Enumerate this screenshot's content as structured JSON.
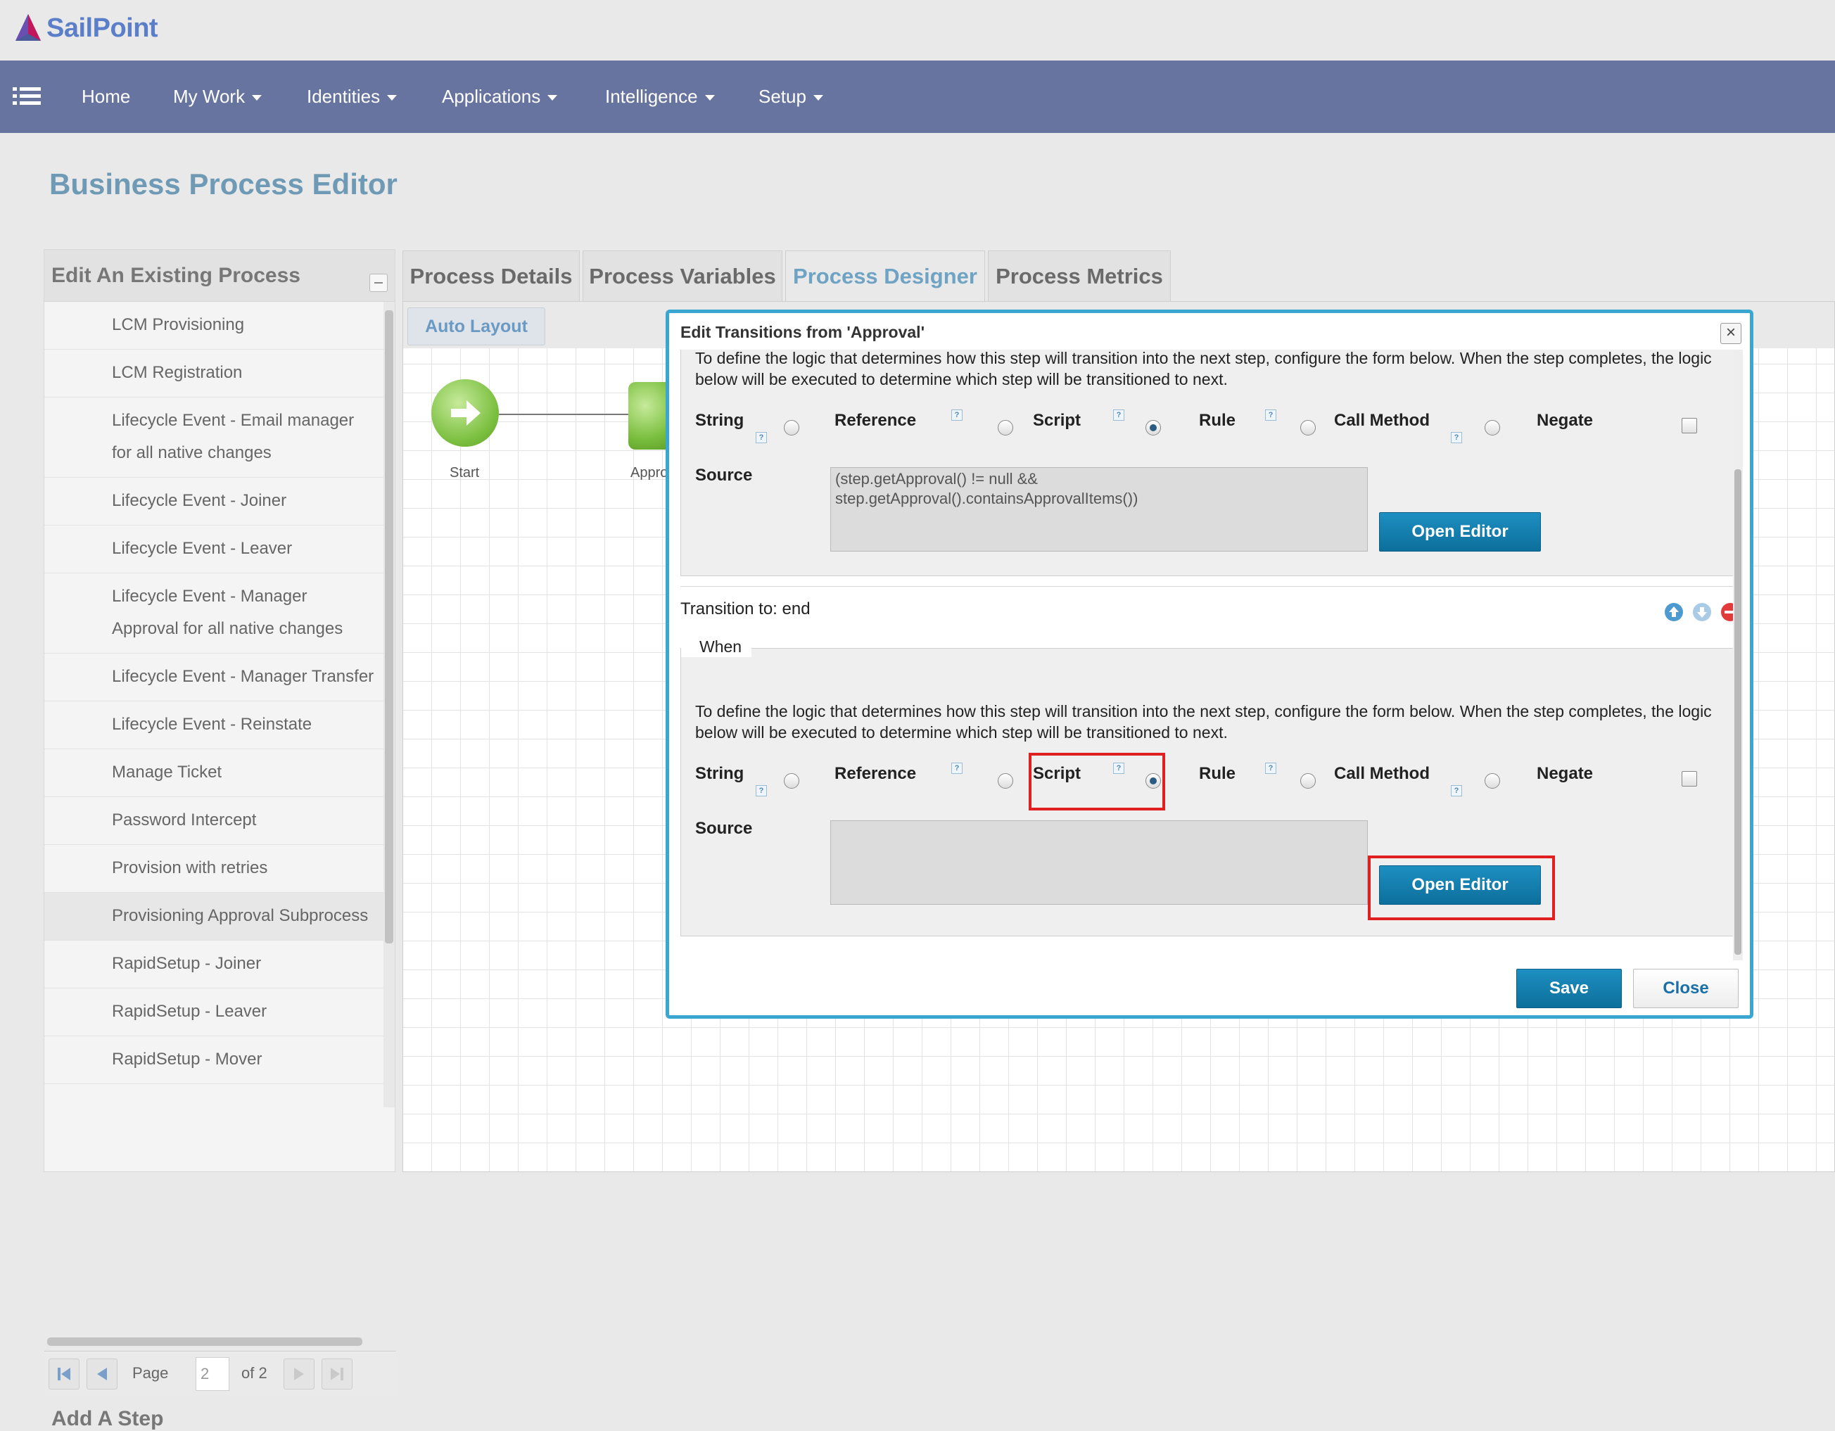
{
  "app": {
    "brand": "SailPoint",
    "brand_color": "#5b7ec9"
  },
  "nav": {
    "menu_icon": "list-icon",
    "items": [
      {
        "label": "Home",
        "dropdown": false
      },
      {
        "label": "My Work",
        "dropdown": true
      },
      {
        "label": "Identities",
        "dropdown": true
      },
      {
        "label": "Applications",
        "dropdown": true
      },
      {
        "label": "Intelligence",
        "dropdown": true
      },
      {
        "label": "Setup",
        "dropdown": true
      }
    ]
  },
  "page": {
    "title": "Business Process Editor"
  },
  "left_panel": {
    "title": "Edit An Existing Process",
    "items": [
      "LCM Provisioning",
      "LCM Registration",
      "Lifecycle Event - Email manager for all native changes",
      "Lifecycle Event - Joiner",
      "Lifecycle Event - Leaver",
      "Lifecycle Event - Manager Approval for all native changes",
      "Lifecycle Event - Manager Transfer",
      "Lifecycle Event - Reinstate",
      "Manage Ticket",
      "Password Intercept",
      "Provision with retries",
      "Provisioning Approval Subprocess",
      "RapidSetup - Joiner",
      "RapidSetup - Leaver",
      "RapidSetup - Mover"
    ],
    "selected_index": 11,
    "pager": {
      "page_label": "Page",
      "page_value": "2",
      "of_label": "of 2"
    },
    "add_step_title": "Add A Step"
  },
  "tabs": [
    {
      "label": "Process Details",
      "active": false
    },
    {
      "label": "Process Variables",
      "active": false
    },
    {
      "label": "Process Designer",
      "active": true
    },
    {
      "label": "Process Metrics",
      "active": false
    }
  ],
  "designer": {
    "auto_layout_label": "Auto Layout",
    "start_label": "Start",
    "approval_label": "Appro"
  },
  "dialog": {
    "title": "Edit Transitions from 'Approval'",
    "description": "To define the logic that determines how this step will transition into the next step, configure the form below. When the step completes, the logic below will be executed to determine which step will be transitioned to next.",
    "options": [
      "String",
      "Reference",
      "Script",
      "Rule",
      "Call Method",
      "Negate"
    ],
    "source_label": "Source",
    "open_editor_label": "Open Editor",
    "help_glyph": "?",
    "transition_1": {
      "selected_option": "Script",
      "source_value": "(step.getApproval() != null &&\nstep.getApproval().containsApprovalItems())"
    },
    "transition_2": {
      "label": "Transition to: end",
      "when_label": "When",
      "selected_option": "Script",
      "source_value": ""
    },
    "save_label": "Save",
    "close_label": "Close",
    "close_icon": "x-icon",
    "accent_color": "#3aa7d3",
    "highlight_color": "#e02020"
  }
}
